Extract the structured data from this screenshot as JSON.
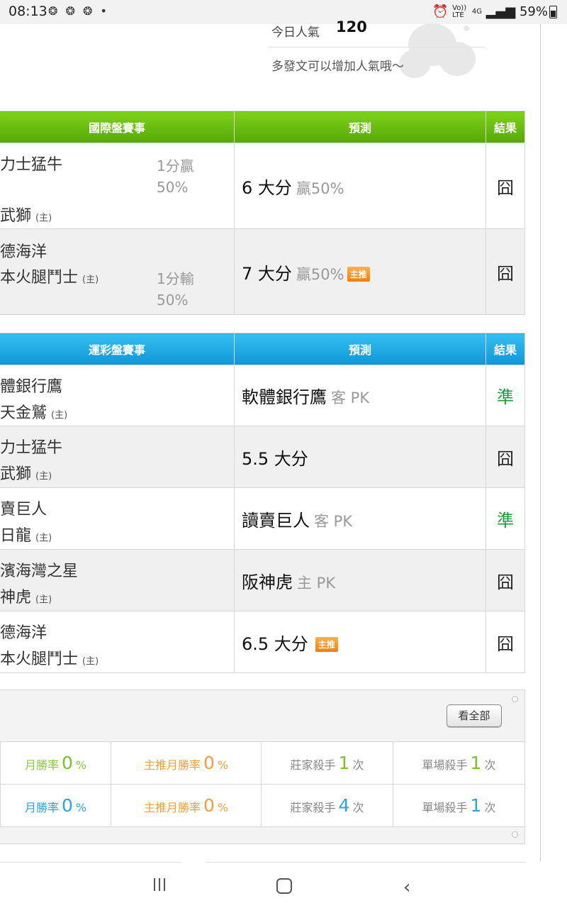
{
  "status_bar": {
    "time": "08:13",
    "notif_icons": "❂ ❂ ❂ •",
    "volte": "Vo)) LTE",
    "network": "4G",
    "battery": "59%"
  },
  "popularity": {
    "label": "今日人氣",
    "value": "120",
    "hint": "多發文可以增加人氣哦～"
  },
  "intl_table": {
    "headers": [
      "國際盤賽事",
      "預測",
      "結果"
    ],
    "rows": [
      {
        "team_top": "力士猛牛",
        "team_bottom": "武獅",
        "home_tag": "(主)",
        "handicap_1": "1分贏",
        "handicap_2": "50%",
        "prediction": "6 大分",
        "prediction_sub": "贏50%",
        "badge": "",
        "result": "囧"
      },
      {
        "team_top": "德海洋",
        "team_bottom": "本火腿鬥士",
        "home_tag": "(主)",
        "handicap_1": "1分輸",
        "handicap_2": "50%",
        "prediction": "7 大分",
        "prediction_sub": "贏50%",
        "badge": "主推",
        "result": "囧"
      }
    ]
  },
  "lottery_table": {
    "headers": [
      "運彩盤賽事",
      "預測",
      "結果"
    ],
    "rows": [
      {
        "team_top": "體銀行鷹",
        "team_bottom": "天金鷲",
        "home_tag": "(主)",
        "prediction": "軟體銀行鷹",
        "prediction_sub": "客 PK",
        "badge": "",
        "result": "準"
      },
      {
        "team_top": "力士猛牛",
        "team_bottom": "武獅",
        "home_tag": "(主)",
        "prediction": "5.5 大分",
        "prediction_sub": "",
        "badge": "",
        "result": "囧"
      },
      {
        "team_top": "賣巨人",
        "team_bottom": "日龍",
        "home_tag": "(主)",
        "prediction": "讀賣巨人",
        "prediction_sub": "客 PK",
        "badge": "",
        "result": "準"
      },
      {
        "team_top": "濱海灣之星",
        "team_bottom": "神虎",
        "home_tag": "(主)",
        "prediction": "阪神虎",
        "prediction_sub": "主 PK",
        "badge": "",
        "result": "囧"
      },
      {
        "team_top": "德海洋",
        "team_bottom": "本火腿鬥士",
        "home_tag": "(主)",
        "prediction": "6.5 大分",
        "prediction_sub": "",
        "badge": "主推",
        "result": "囧"
      }
    ]
  },
  "stats": {
    "view_all": "看全部",
    "rows": [
      {
        "monthly_label": "月勝率",
        "monthly_value": "0",
        "main_label": "主推月勝率",
        "main_value": "0",
        "percent": "%",
        "banker_label": "莊家殺手",
        "banker_value": "1",
        "single_label": "單場殺手",
        "single_value": "1",
        "times": "次"
      },
      {
        "monthly_label": "月勝率",
        "monthly_value": "0",
        "main_label": "主推月勝率",
        "main_value": "0",
        "percent": "%",
        "banker_label": "莊家殺手",
        "banker_value": "4",
        "single_label": "單場殺手",
        "single_value": "1",
        "times": "次"
      }
    ]
  },
  "colors": {
    "intl_header": "#5cb30c",
    "lottery_header": "#1ba0dd",
    "hit_result": "#1d9a3a",
    "badge": "#f08a1c"
  },
  "nav_icons": [
    "recent-apps-icon",
    "home-icon",
    "back-icon"
  ]
}
